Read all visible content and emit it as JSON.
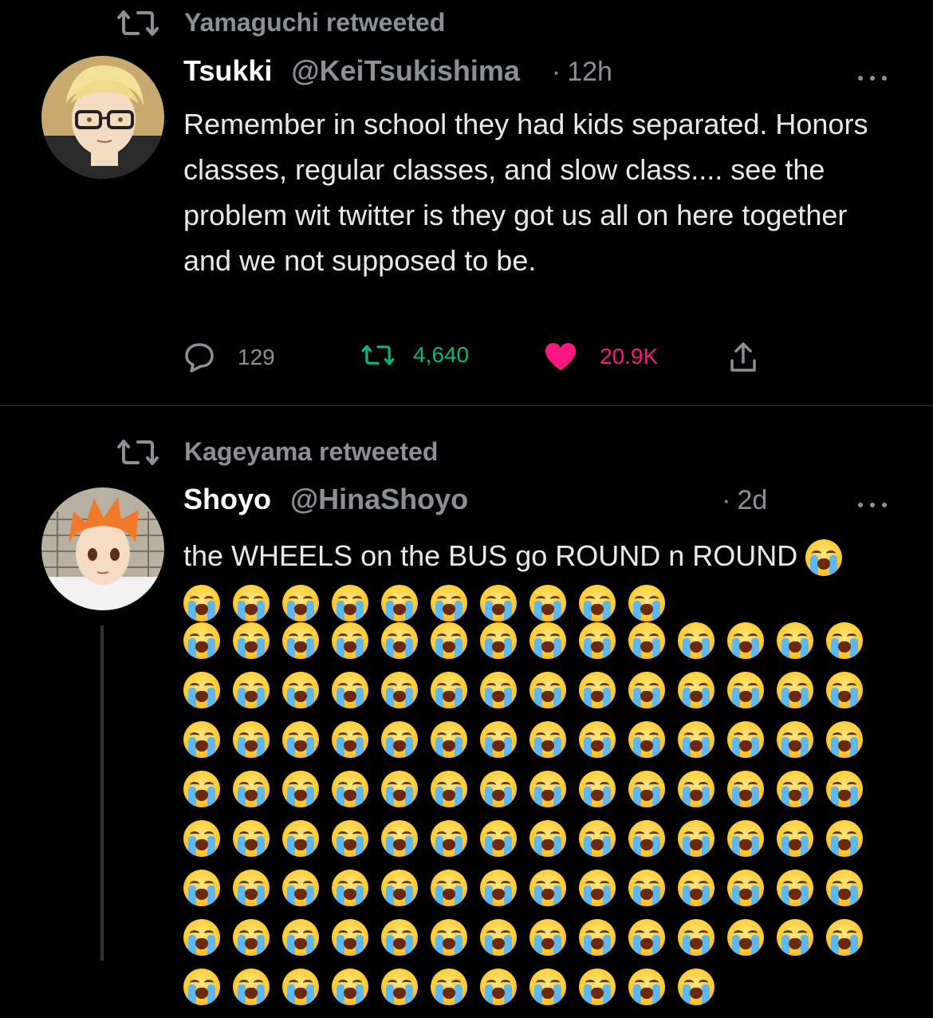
{
  "tweets": [
    {
      "retweeted_by": "Yamaguchi retweeted",
      "name": "Tsukki",
      "handle": "@KeiTsukishima",
      "time": "12h",
      "text": "Remember in school they had kids separated. Honors classes, regular classes, and slow class.... see the problem wit twitter is they got us all on here together and we not supposed to be.",
      "replies": "129",
      "retweets": "4,640",
      "likes": "20.9K",
      "liked": true
    },
    {
      "retweeted_by": "Kageyama retweeted",
      "name": "Shoyo",
      "handle": "@HinaShoyo",
      "time": "2d",
      "text": "the WHEELS on the BUS go ROUND n ROUND",
      "emoji": "loudly-crying-face"
    }
  ],
  "colors": {
    "background": "#000000",
    "muted": "#8b9096",
    "retweet_green": "#00ba7c",
    "like_pink": "#f91880"
  },
  "icons": [
    "retweet-icon",
    "reply-icon",
    "like-icon",
    "share-icon",
    "more-icon"
  ]
}
